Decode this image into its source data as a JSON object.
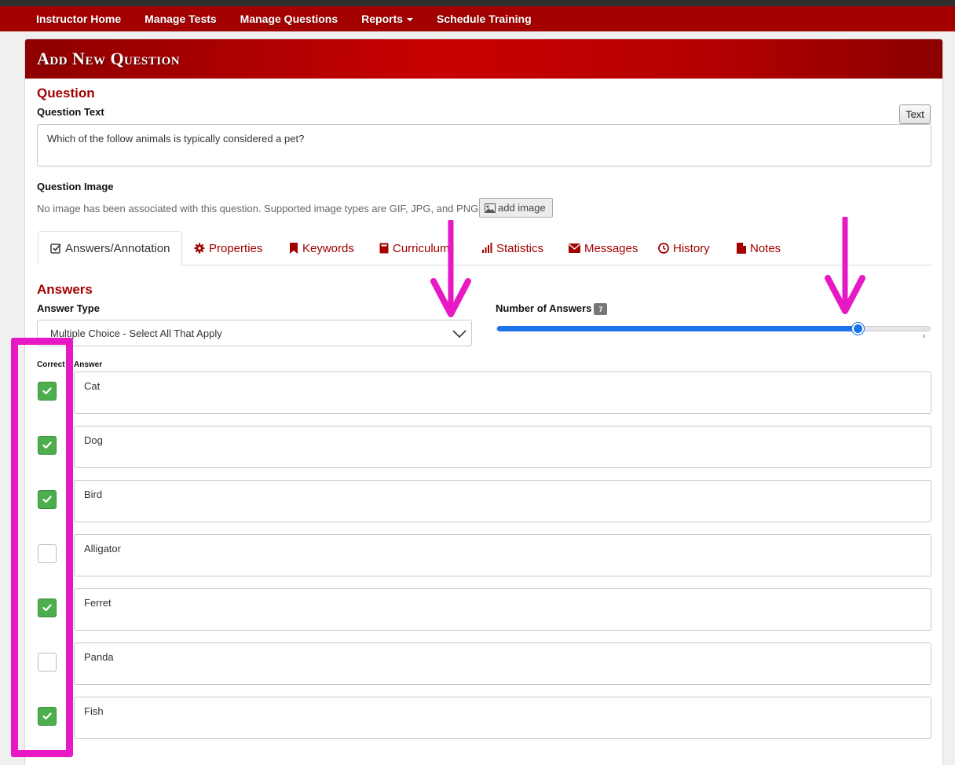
{
  "nav": {
    "items": [
      "Instructor Home",
      "Manage Tests",
      "Manage Questions",
      "Reports",
      "Schedule Training"
    ]
  },
  "panel": {
    "title": "Add New Question"
  },
  "question": {
    "section_title": "Question",
    "text_label": "Question Text",
    "text_toggle": "Text",
    "text_value": "Which of the follow animals is typically considered a pet?",
    "image_label": "Question Image",
    "image_note": "No image has been associated with this question. Supported image types are GIF, JPG, and PNG.",
    "add_image": "add image"
  },
  "tabs": [
    {
      "label": "Answers/Annotation",
      "icon": "check-square-icon",
      "active": true
    },
    {
      "label": "Properties",
      "icon": "gear-icon"
    },
    {
      "label": "Keywords",
      "icon": "bookmark-icon"
    },
    {
      "label": "Curriculum",
      "icon": "book-icon"
    },
    {
      "label": "Statistics",
      "icon": "bar-chart-icon"
    },
    {
      "label": "Messages",
      "icon": "envelope-icon"
    },
    {
      "label": "History",
      "icon": "clock-icon"
    },
    {
      "label": "Notes",
      "icon": "file-icon"
    }
  ],
  "answers": {
    "section_title": "Answers",
    "type_label": "Answer Type",
    "type_value": "Multiple Choice - Select All That Apply",
    "count_label": "Number of Answers",
    "count_value": "7",
    "slider_fraction": 0.83,
    "correct_label": "Correct",
    "answer_label": "Answer",
    "items": [
      {
        "text": "Cat",
        "correct": true
      },
      {
        "text": "Dog",
        "correct": true
      },
      {
        "text": "Bird",
        "correct": true
      },
      {
        "text": "Alligator",
        "correct": false
      },
      {
        "text": "Ferret",
        "correct": true
      },
      {
        "text": "Panda",
        "correct": false
      },
      {
        "text": "Fish",
        "correct": true
      }
    ]
  },
  "colors": {
    "brand_red": "#a30000",
    "annotation_magenta": "#e619c4",
    "checkbox_green": "#4cae4c",
    "slider_blue": "#1a73e8"
  }
}
